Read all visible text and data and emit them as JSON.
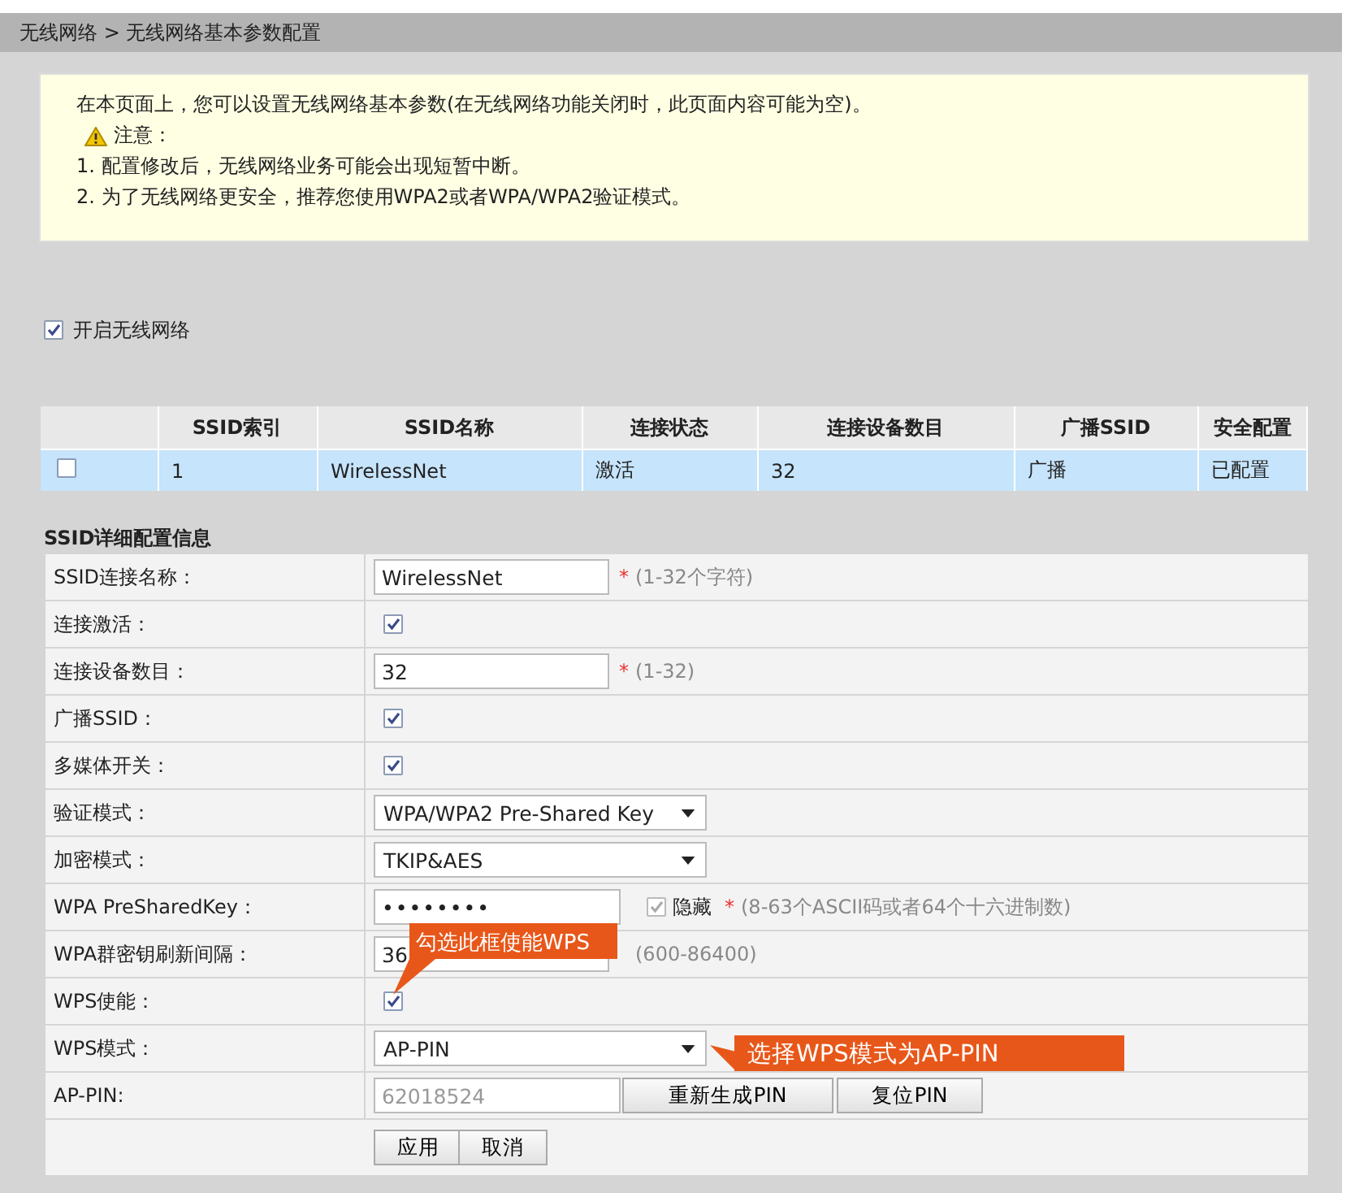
{
  "breadcrumb": "无线网络 > 无线网络基本参数配置",
  "notice": {
    "intro": "在本页面上，您可以设置无线网络基本参数(在无线网络功能关闭时，此页面内容可能为空)。",
    "warning_label": "注意：",
    "items": [
      "1. 配置修改后，无线网络业务可能会出现短暂中断。",
      "2. 为了无线网络更安全，推荐您使用WPA2或者WPA/WPA2验证模式。"
    ]
  },
  "enable_wireless": {
    "label": "开启无线网络",
    "checked": true
  },
  "ssid_table": {
    "columns": [
      "SSID索引",
      "SSID名称",
      "连接状态",
      "连接设备数目",
      "广播SSID",
      "安全配置"
    ],
    "rows": [
      {
        "checked": false,
        "cells": [
          "1",
          "WirelessNet",
          "激活",
          "32",
          "广播",
          "已配置"
        ]
      }
    ]
  },
  "detail": {
    "title": "SSID详细配置信息",
    "rows": [
      {
        "kind": "text",
        "label": "SSID连接名称：",
        "value": "WirelessNet",
        "mark": "*",
        "hint": "(1-32个字符)"
      },
      {
        "kind": "checkbox",
        "label": "连接激活：",
        "checked": true
      },
      {
        "kind": "text",
        "label": "连接设备数目：",
        "value": "32",
        "mark": "*",
        "hint": "(1-32)"
      },
      {
        "kind": "checkbox",
        "label": "广播SSID：",
        "checked": true
      },
      {
        "kind": "checkbox",
        "label": "多媒体开关：",
        "checked": true
      },
      {
        "kind": "select",
        "label": "验证模式：",
        "value": "WPA/WPA2 Pre-Shared Key"
      },
      {
        "kind": "select",
        "label": "加密模式：",
        "value": "TKIP&AES"
      },
      {
        "kind": "password",
        "label": "WPA PreSharedKey：",
        "value": "••••••••",
        "hide_checked": true,
        "hide_label": "隐藏",
        "mark": "*",
        "hint": "(8-63个ASCII码或者64个十六进制数)"
      },
      {
        "kind": "text",
        "label": "WPA群密钥刷新间隔：",
        "value": "36",
        "hint": "(600-86400)"
      },
      {
        "kind": "checkbox",
        "label": "WPS使能：",
        "checked": true
      },
      {
        "kind": "select",
        "label": "WPS模式：",
        "value": "AP-PIN"
      },
      {
        "kind": "pin",
        "label": "AP-PIN:",
        "value": "62018524",
        "disabled": true,
        "buttons": [
          "重新生成PIN",
          "复位PIN"
        ]
      }
    ]
  },
  "actions": [
    "应用",
    "取消"
  ],
  "callouts": [
    "勾选此框使能WPS",
    "选择WPS模式为AP-PIN"
  ]
}
